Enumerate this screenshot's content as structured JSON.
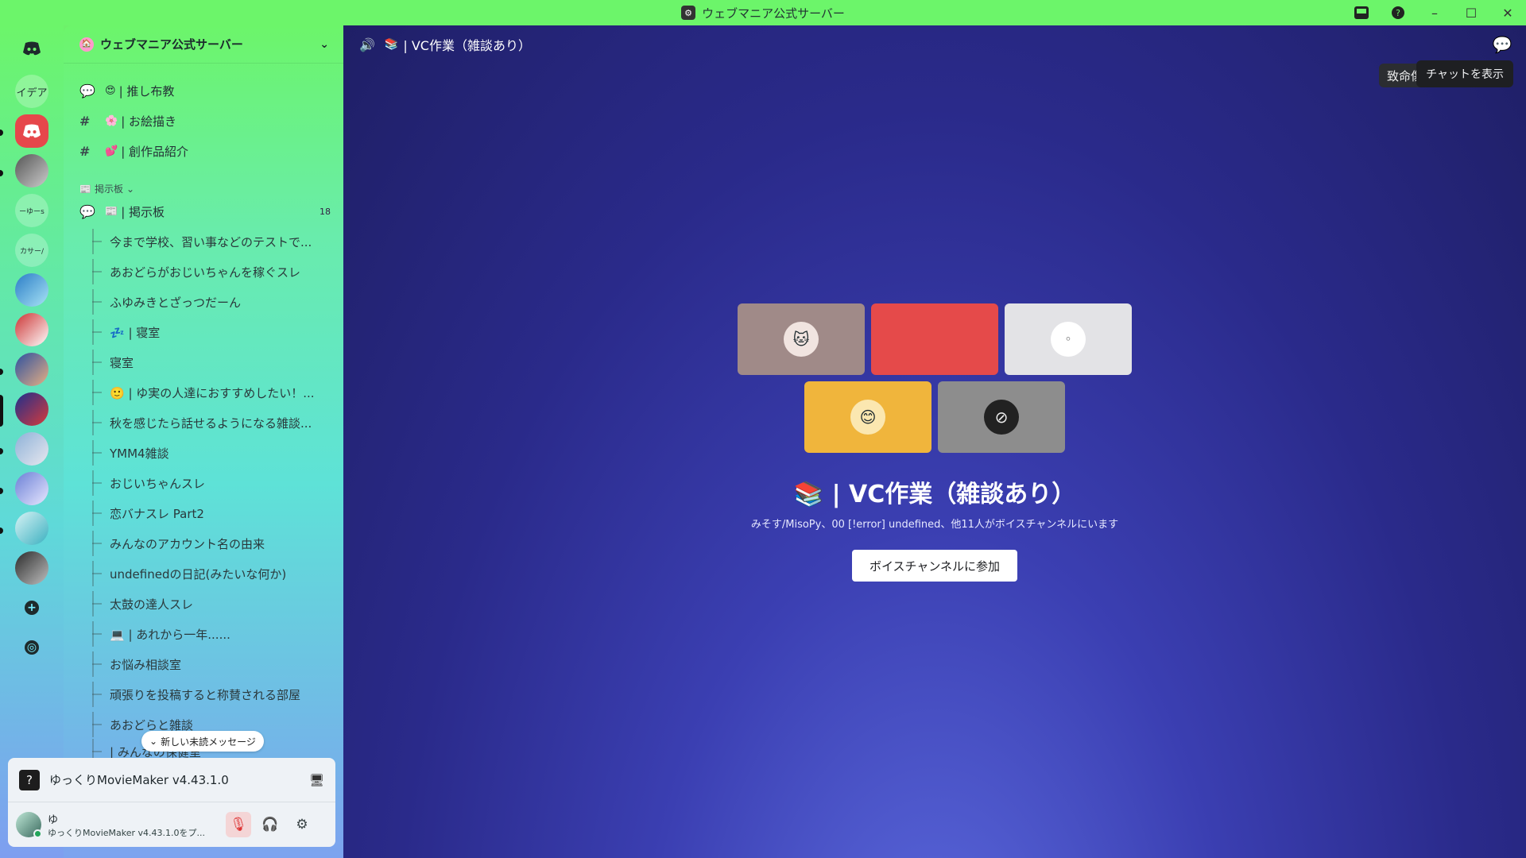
{
  "window": {
    "title": "ウェブマニア公式サーバー"
  },
  "rail": {
    "items": [
      {
        "type": "home",
        "icon": "discord-icon"
      },
      {
        "type": "text",
        "label": "イデア"
      },
      {
        "type": "icon",
        "icon": "discord-icon"
      },
      {
        "type": "avatar"
      },
      {
        "type": "text",
        "label": "ーゆーs"
      },
      {
        "type": "text",
        "label": "カサー/"
      },
      {
        "type": "avatar"
      },
      {
        "type": "avatar"
      },
      {
        "type": "avatar"
      },
      {
        "type": "avatar"
      },
      {
        "type": "avatar"
      },
      {
        "type": "avatar"
      },
      {
        "type": "avatar"
      },
      {
        "type": "avatar"
      },
      {
        "type": "add",
        "icon": "plus-icon"
      },
      {
        "type": "discover",
        "icon": "compass-icon"
      }
    ]
  },
  "sidebar": {
    "server_name": "ウェブマニア公式サーバー",
    "channels": [
      {
        "icon": "forum-icon",
        "emoji": "😍",
        "name": "| 推し布教"
      },
      {
        "icon": "hash-icon",
        "emoji": "🌸",
        "name": "| お絵描き"
      },
      {
        "icon": "hash-icon",
        "emoji": "💕",
        "name": "| 創作品紹介"
      }
    ],
    "category": "掲示板",
    "forum": {
      "emoji": "📰",
      "name": "| 掲示板",
      "count": "18"
    },
    "threads": [
      "今まで学校、習い事などのテストで...",
      "あおどらがおじいちゃんを稼ぐスレ",
      "ふゆみきとざっつだーん",
      "💤 | 寝室",
      "寝室",
      "🙂 | ゆ実の人達におすすめしたい！...",
      "秋を感じたら話せるようになる雑談...",
      "YMM4雑談",
      "おじいちゃんスレ",
      "恋バナスレ Part2",
      "みんなのアカウント名の由来",
      "undefinedの日記(みたいな何か)",
      "太鼓の達人スレ",
      "💻 | あれから一年......",
      "お悩み相談室",
      "頑張りを投稿すると称賛される部屋",
      "あおどらと雑談",
      "| みんなの保健室"
    ],
    "new_unread": "新しい未読メッセージ"
  },
  "activity": {
    "app_name": "ゆっくりMovieMaker v4.43.1.0"
  },
  "user": {
    "name": "ゆ",
    "status": "ゆっくりMovieMaker v4.43.1.0をプ..."
  },
  "voice": {
    "channel_emoji": "📚",
    "channel_name": "| VC作業（雑談あり）",
    "participants_text": "みそす/MisoPy、00 [!error] undefined、他11人がボイスチャンネルにいます",
    "join_label": "ボイスチャンネルに参加",
    "tooltip_partial": "致命傷で済",
    "tooltip_chat": "チャットを表示",
    "tiles": [
      {
        "bg": "#a08a88",
        "avatar": "🐱"
      },
      {
        "bg": "#e54a4a",
        "avatar": ""
      },
      {
        "bg": "#e3e3e6",
        "avatar": "⚪"
      },
      {
        "bg": "#f0b53c",
        "avatar": "😊"
      },
      {
        "bg": "#8d8d8d",
        "avatar": "⊘"
      }
    ]
  },
  "colors": {
    "accent_green": "#6cf56a",
    "voice_bg": "#2a2a8a",
    "muted_red": "#d33"
  }
}
